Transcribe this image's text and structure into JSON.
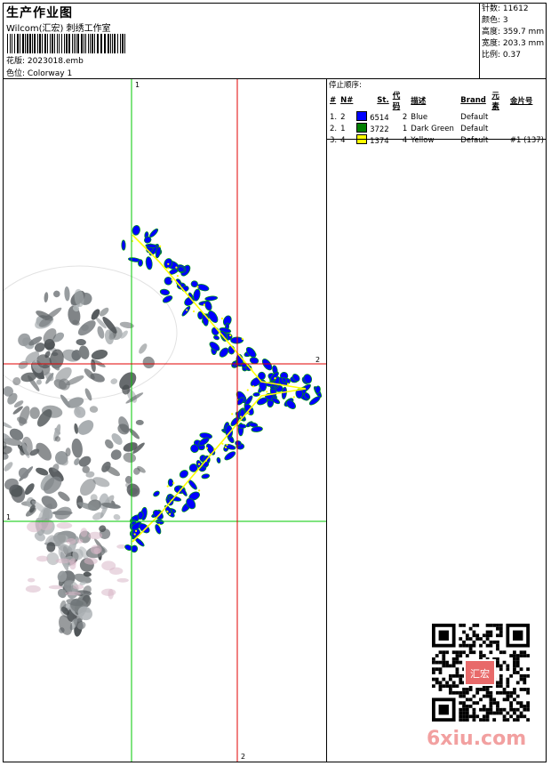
{
  "header": {
    "title": "生产作业图",
    "company": "Wilcom(汇宏) 刺绣工作室",
    "design_label": "花版:",
    "design_value": "2023018.emb",
    "colorway_label": "色位:",
    "colorway_value": "Colorway 1"
  },
  "info": [
    {
      "label": "针数:",
      "value": "11612"
    },
    {
      "label": "颜色:",
      "value": "3"
    },
    {
      "label": "高度:",
      "value": "359.7 mm"
    },
    {
      "label": "宽度:",
      "value": "203.3 mm"
    },
    {
      "label": "比例:",
      "value": "0.37"
    }
  ],
  "stop_sequence": {
    "title": "停止顺序:",
    "columns": [
      "#",
      "N#",
      "St.",
      "代码",
      "描述",
      "Brand",
      "元素",
      "金片号"
    ],
    "rows": [
      {
        "num": "1.",
        "needle": "2",
        "color": "#0000ff",
        "stitches": "6514",
        "code": "2",
        "desc": "Blue",
        "brand": "Default",
        "element": "",
        "sequin": ""
      },
      {
        "num": "2.",
        "needle": "1",
        "color": "#008000",
        "stitches": "3722",
        "code": "1",
        "desc": "Dark Green",
        "brand": "Default",
        "element": "",
        "sequin": ""
      },
      {
        "num": "3.",
        "needle": "4",
        "color": "#ffff00",
        "stitches": "1374",
        "code": "4",
        "desc": "Yellow",
        "brand": "Default",
        "element": "",
        "sequin": "#1 (137)"
      }
    ]
  },
  "guides": {
    "green_label_top": "1",
    "green_label_left": "1",
    "red_label_right": "2",
    "red_label_bottom": "2"
  },
  "colors": {
    "blue": "#0000ff",
    "green": "#00c800",
    "yellow": "#ffff00",
    "red": "#e00000",
    "watermark": "#f2a0a0"
  },
  "watermark": "6xiu.com",
  "seal_text": "汇宏"
}
